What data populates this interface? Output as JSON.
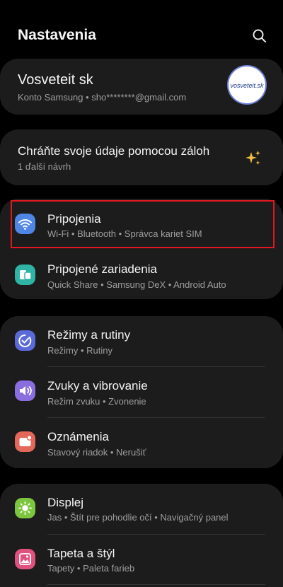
{
  "header": {
    "title": "Nastavenia",
    "search_icon": "search-icon"
  },
  "account": {
    "name": "Vosveteit sk",
    "subtitle": "Konto Samsung  •  sho********@gmail.com",
    "avatar_text": "vosveteit.sk",
    "avatar_border_color": "#6b7fd9"
  },
  "backup": {
    "title": "Chráňte svoje údaje pomocou záloh",
    "subtitle": "1 ďalší návrh",
    "icon": "sparkle-icon",
    "icon_color": "#f5c043"
  },
  "items": [
    {
      "title": "Pripojenia",
      "subtitle": "Wi-Fi  •  Bluetooth  •  Správca kariet SIM",
      "icon": "wifi-icon",
      "color": "#4f86e6",
      "highlighted": true
    },
    {
      "title": "Pripojené zariadenia",
      "subtitle": "Quick Share  •  Samsung DeX  •  Android Auto",
      "icon": "connected-devices-icon",
      "color": "#2fb3a5"
    },
    {
      "title": "Režimy a rutiny",
      "subtitle": "Režimy  •  Rutiny",
      "icon": "modes-routines-icon",
      "color": "#5a6ad8"
    },
    {
      "title": "Zvuky a vibrovanie",
      "subtitle": "Režim zvuku  •  Zvonenie",
      "icon": "sound-icon",
      "color": "#8a6ee0"
    },
    {
      "title": "Oznámenia",
      "subtitle": "Stavový riadok  •  Nerušiť",
      "icon": "notifications-icon",
      "color": "#e3685a"
    },
    {
      "title": "Displej",
      "subtitle": "Jas  •  Štít pre pohodlie očí  •  Navigačný panel",
      "icon": "display-icon",
      "color": "#7cc63f"
    },
    {
      "title": "Tapeta a štýl",
      "subtitle": "Tapety  •  Paleta farieb",
      "icon": "wallpaper-icon",
      "color": "#e0527e"
    }
  ],
  "highlight_color": "#e01820"
}
